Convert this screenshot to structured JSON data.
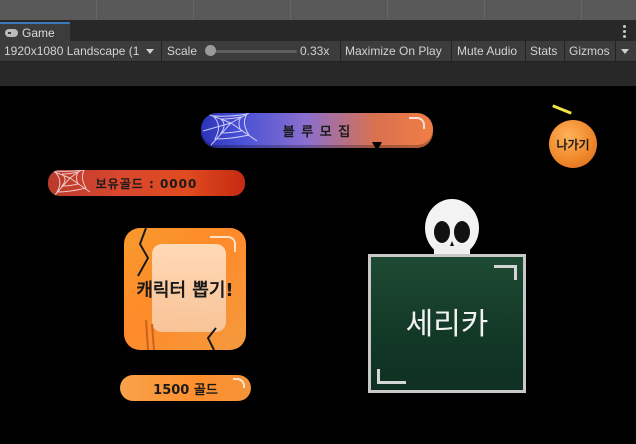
{
  "editor": {
    "tab_label": "Game",
    "resolution_label": "1920x1080 Landscape (1",
    "scale_label": "Scale",
    "scale_value": "0.33x",
    "maximize_label": "Maximize On Play",
    "mute_label": "Mute Audio",
    "stats_label": "Stats",
    "gizmos_label": "Gizmos"
  },
  "game": {
    "recruit_button": "블 루 모 집",
    "gold_label": "보유골드 : 0000",
    "exit_button": "나가기",
    "draw_button": "캐릭터 뽑기!",
    "cost_label": "1500 골드",
    "board_name": "세리카"
  }
}
